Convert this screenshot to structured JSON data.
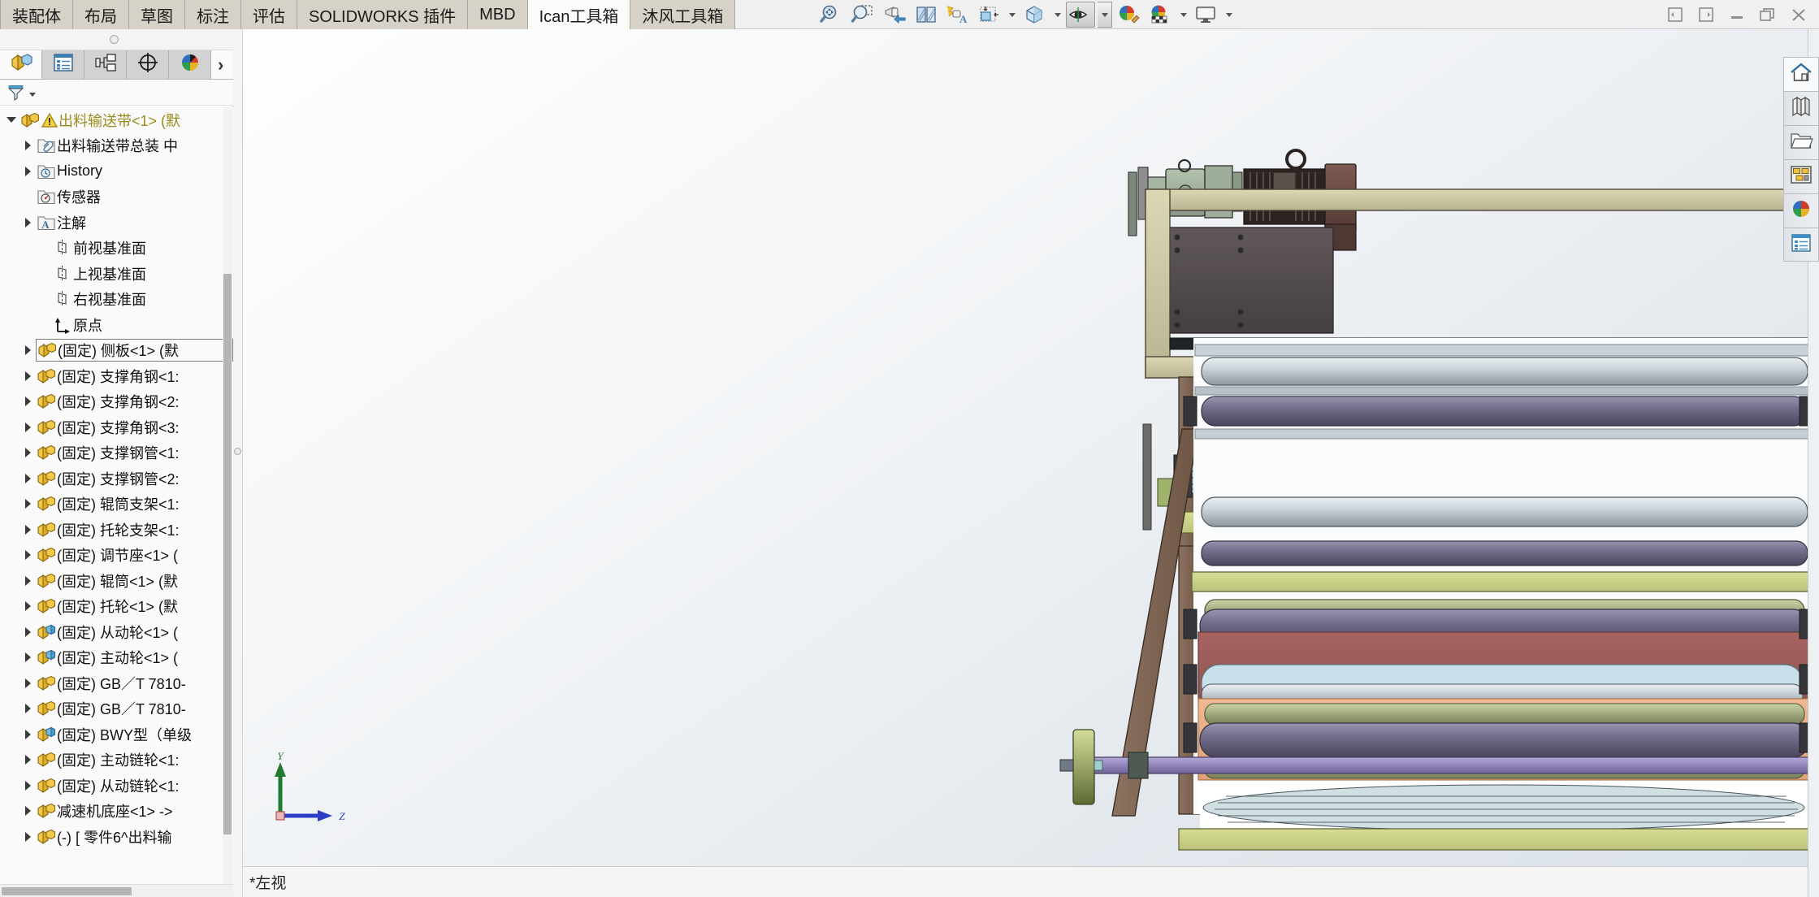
{
  "window": {
    "controls": [
      {
        "name": "pin-left-button",
        "icon": "panel-left-icon"
      },
      {
        "name": "pin-right-button",
        "icon": "panel-right-icon"
      },
      {
        "name": "minimize-button",
        "icon": "minimize-icon"
      },
      {
        "name": "restore-button",
        "icon": "restore-icon"
      },
      {
        "name": "close-button",
        "icon": "close-icon"
      }
    ]
  },
  "ribbon": {
    "tabs": [
      {
        "label": "装配体",
        "active": false
      },
      {
        "label": "布局",
        "active": false
      },
      {
        "label": "草图",
        "active": false
      },
      {
        "label": "标注",
        "active": false
      },
      {
        "label": "评估",
        "active": false
      },
      {
        "label": "SOLIDWORKS 插件",
        "active": false
      },
      {
        "label": "MBD",
        "active": false
      },
      {
        "label": "Ican工具箱",
        "active": true
      },
      {
        "label": "沐风工具箱",
        "active": false
      }
    ]
  },
  "view_toolbar": {
    "buttons": [
      {
        "label": "整屏显示全图",
        "icon": "zoom-to-fit-icon",
        "pressed": false,
        "has_caret": false
      },
      {
        "label": "局部放大",
        "icon": "zoom-to-area-icon",
        "pressed": false,
        "has_caret": false
      },
      {
        "label": "上一视图",
        "icon": "previous-view-icon",
        "pressed": false,
        "has_caret": false
      },
      {
        "label": "剖面视图",
        "icon": "section-view-icon",
        "pressed": false,
        "has_caret": false
      },
      {
        "label": "动态注解视图",
        "icon": "annotation-view-icon",
        "pressed": false,
        "has_caret": false
      },
      {
        "label": "视图定向",
        "icon": "view-orientation-icon",
        "pressed": false,
        "has_caret": true
      },
      {
        "label": "显示样式",
        "icon": "display-style-icon",
        "pressed": false,
        "has_caret": true
      },
      {
        "label": "隐藏/显示项目",
        "icon": "hide-show-items-icon",
        "pressed": true,
        "has_caret": true
      },
      {
        "label": "编辑外观",
        "icon": "edit-appearance-icon",
        "pressed": false,
        "has_caret": false
      },
      {
        "label": "应用布景",
        "icon": "apply-scene-icon",
        "pressed": false,
        "has_caret": true
      },
      {
        "label": "视图设定",
        "icon": "viewport-icon",
        "pressed": false,
        "has_caret": true
      }
    ]
  },
  "feature_manager": {
    "tabs": [
      {
        "name": "feature-manager-tab",
        "icon": "feature-tree-icon",
        "active": true
      },
      {
        "name": "property-manager-tab",
        "icon": "property-manager-icon",
        "active": false
      },
      {
        "name": "configuration-manager-tab",
        "icon": "configuration-manager-icon",
        "active": false
      },
      {
        "name": "dimxpert-manager-tab",
        "icon": "dimxpert-icon",
        "active": false
      },
      {
        "name": "display-manager-tab",
        "icon": "display-manager-icon",
        "active": false
      }
    ],
    "more_label": "›",
    "filter_label": "过滤器"
  },
  "tree": {
    "items": [
      {
        "label": "出料输送带<1> (默",
        "icon": "assembly-icon",
        "indent": 0,
        "arrow": "open",
        "warning": true,
        "root": true,
        "selected": false
      },
      {
        "label": "出料输送带总装 中",
        "icon": "annotations-folder-icon",
        "indent": 1,
        "arrow": "closed",
        "warning": false,
        "root": false,
        "selected": false
      },
      {
        "label": "History",
        "icon": "history-folder-icon",
        "indent": 1,
        "arrow": "closed",
        "warning": false,
        "root": false,
        "selected": false
      },
      {
        "label": "传感器",
        "icon": "sensors-folder-icon",
        "indent": 1,
        "arrow": "none",
        "warning": false,
        "root": false,
        "selected": false
      },
      {
        "label": "注解",
        "icon": "annotations-a-folder-icon",
        "indent": 1,
        "arrow": "closed",
        "warning": false,
        "root": false,
        "selected": false
      },
      {
        "label": "前视基准面",
        "icon": "plane-icon",
        "indent": 2,
        "arrow": "none",
        "warning": false,
        "root": false,
        "selected": false
      },
      {
        "label": "上视基准面",
        "icon": "plane-icon",
        "indent": 2,
        "arrow": "none",
        "warning": false,
        "root": false,
        "selected": false
      },
      {
        "label": "右视基准面",
        "icon": "plane-icon",
        "indent": 2,
        "arrow": "none",
        "warning": false,
        "root": false,
        "selected": false
      },
      {
        "label": "原点",
        "icon": "origin-icon",
        "indent": 2,
        "arrow": "none",
        "warning": false,
        "root": false,
        "selected": false
      },
      {
        "label": "(固定) 侧板<1> (默",
        "icon": "part-icon",
        "indent": 1,
        "arrow": "closed",
        "warning": false,
        "root": false,
        "selected": true
      },
      {
        "label": "(固定) 支撑角钢<1:",
        "icon": "part-icon",
        "indent": 1,
        "arrow": "closed",
        "warning": false,
        "root": false,
        "selected": false
      },
      {
        "label": "(固定) 支撑角钢<2:",
        "icon": "part-icon",
        "indent": 1,
        "arrow": "closed",
        "warning": false,
        "root": false,
        "selected": false
      },
      {
        "label": "(固定) 支撑角钢<3:",
        "icon": "part-icon",
        "indent": 1,
        "arrow": "closed",
        "warning": false,
        "root": false,
        "selected": false
      },
      {
        "label": "(固定) 支撑钢管<1:",
        "icon": "part-icon",
        "indent": 1,
        "arrow": "closed",
        "warning": false,
        "root": false,
        "selected": false
      },
      {
        "label": "(固定) 支撑钢管<2:",
        "icon": "part-icon",
        "indent": 1,
        "arrow": "closed",
        "warning": false,
        "root": false,
        "selected": false
      },
      {
        "label": "(固定) 辊筒支架<1:",
        "icon": "part-icon",
        "indent": 1,
        "arrow": "closed",
        "warning": false,
        "root": false,
        "selected": false
      },
      {
        "label": "(固定) 托轮支架<1:",
        "icon": "part-icon",
        "indent": 1,
        "arrow": "closed",
        "warning": false,
        "root": false,
        "selected": false
      },
      {
        "label": "(固定) 调节座<1> (",
        "icon": "part-icon",
        "indent": 1,
        "arrow": "closed",
        "warning": false,
        "root": false,
        "selected": false
      },
      {
        "label": "(固定) 辊筒<1> (默",
        "icon": "part-icon",
        "indent": 1,
        "arrow": "closed",
        "warning": false,
        "root": false,
        "selected": false
      },
      {
        "label": "(固定) 托轮<1> (默",
        "icon": "part-icon",
        "indent": 1,
        "arrow": "closed",
        "warning": false,
        "root": false,
        "selected": false
      },
      {
        "label": "(固定) 从动轮<1> (",
        "icon": "subassembly-icon",
        "indent": 1,
        "arrow": "closed",
        "warning": false,
        "root": false,
        "selected": false
      },
      {
        "label": "(固定) 主动轮<1> (",
        "icon": "subassembly-icon",
        "indent": 1,
        "arrow": "closed",
        "warning": false,
        "root": false,
        "selected": false
      },
      {
        "label": "(固定) GB／T 7810-",
        "icon": "part-icon",
        "indent": 1,
        "arrow": "closed",
        "warning": false,
        "root": false,
        "selected": false
      },
      {
        "label": "(固定) GB／T 7810-",
        "icon": "part-icon",
        "indent": 1,
        "arrow": "closed",
        "warning": false,
        "root": false,
        "selected": false
      },
      {
        "label": "(固定) BWY型（单级",
        "icon": "subassembly-icon",
        "indent": 1,
        "arrow": "closed",
        "warning": false,
        "root": false,
        "selected": false
      },
      {
        "label": "(固定) 主动链轮<1:",
        "icon": "part-icon",
        "indent": 1,
        "arrow": "closed",
        "warning": false,
        "root": false,
        "selected": false
      },
      {
        "label": "(固定) 从动链轮<1:",
        "icon": "part-icon",
        "indent": 1,
        "arrow": "closed",
        "warning": false,
        "root": false,
        "selected": false
      },
      {
        "label": "减速机底座<1> ->",
        "icon": "part-icon",
        "indent": 1,
        "arrow": "closed",
        "warning": false,
        "root": false,
        "selected": false
      },
      {
        "label": "(-) [ 零件6^出料输",
        "icon": "part-icon",
        "indent": 1,
        "arrow": "closed",
        "warning": false,
        "root": false,
        "selected": false
      }
    ]
  },
  "status": {
    "view_label": "*左视"
  },
  "triad": {
    "y_label": "Y",
    "z_label": "Z"
  },
  "task_pane": {
    "buttons": [
      {
        "name": "task-pane-home-button",
        "icon": "home-icon",
        "active": true
      },
      {
        "name": "task-pane-design-library-button",
        "icon": "design-library-icon",
        "active": false
      },
      {
        "name": "task-pane-file-explorer-button",
        "icon": "folder-icon",
        "active": false
      },
      {
        "name": "task-pane-view-palette-button",
        "icon": "view-palette-icon",
        "active": false
      },
      {
        "name": "task-pane-appearances-button",
        "icon": "appearances-sphere-icon",
        "active": false
      },
      {
        "name": "task-pane-custom-properties-button",
        "icon": "custom-properties-icon",
        "active": false
      }
    ]
  },
  "colors": {
    "tab_active_bg": "#fbfbf9",
    "tab_inactive_bg": "#d6d2c8",
    "tree_root_text": "#9a8b1e",
    "graphics_bg_top": "#fefeff",
    "graphics_bg_bottom": "#dbe2e9",
    "frame_tan": "#cdc8a4",
    "frame_brown": "#7e6451",
    "roller_gray": "#b9c2c8",
    "roller_purple": "#6e6a86",
    "belt_red": "#9e5f5c",
    "belt_orange": "#e8a882",
    "belt_green": "#c9d18a",
    "motor_brown": "#6b4a44",
    "gearbox_green": "#9db09a",
    "shaft_purple": "#9a8fc4"
  }
}
